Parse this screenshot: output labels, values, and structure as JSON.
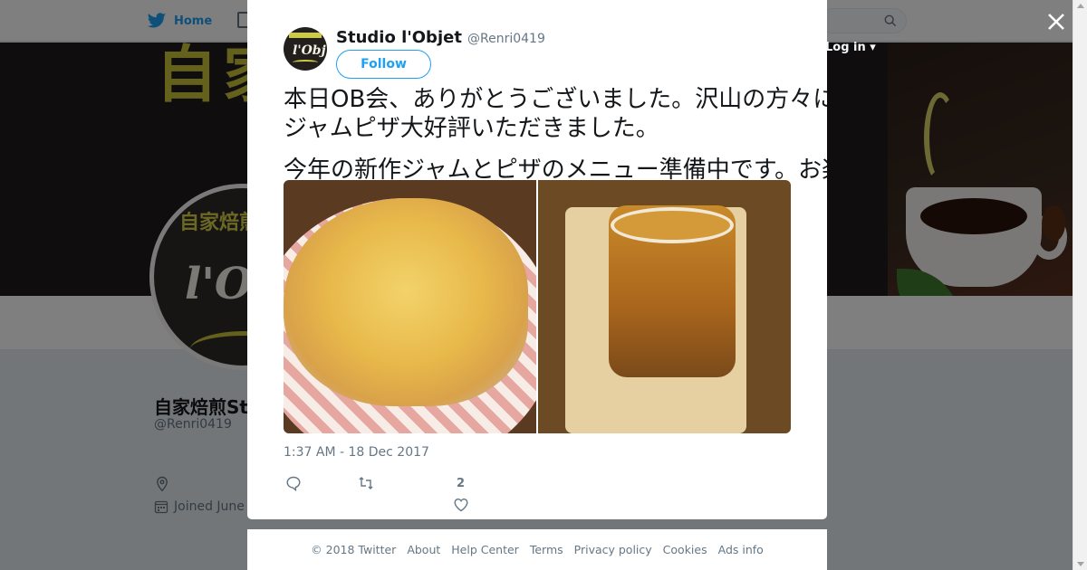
{
  "background": {
    "nav": {
      "home_label": "Home",
      "login_label": "Log in"
    },
    "banner_text": "自家",
    "avatar_text_top": "自家焙煎Cafe",
    "avatar_text_main": "l'Obj",
    "profile": {
      "name": "自家焙煎Studio",
      "handle": "@Renri0419",
      "joined": "Joined June"
    }
  },
  "tweet": {
    "author_name": "Studio l'Objet",
    "author_handle": "@Renri0419",
    "follow_label": "Follow",
    "text_lines": [
      "本日OB会、ありがとうございました。沢山の方々にお越しいただき、",
      "ジャムピザ大好評いただきました。",
      "今年の新作ジャムとピザのメニュー準備中です。お楽しみに。"
    ],
    "images": [
      {
        "alt": "pizza-photo"
      },
      {
        "alt": "jam-jar-photo"
      }
    ],
    "timestamp": "1:37 AM - 18 Dec 2017",
    "like_count": "2"
  },
  "footer": {
    "links": [
      "© 2018 Twitter",
      "About",
      "Help Center",
      "Terms",
      "Privacy policy",
      "Cookies",
      "Ads info"
    ]
  },
  "colors": {
    "accent": "#1da1f2",
    "muted": "#657786",
    "overlay": "rgba(0,0,0,0.5)"
  }
}
